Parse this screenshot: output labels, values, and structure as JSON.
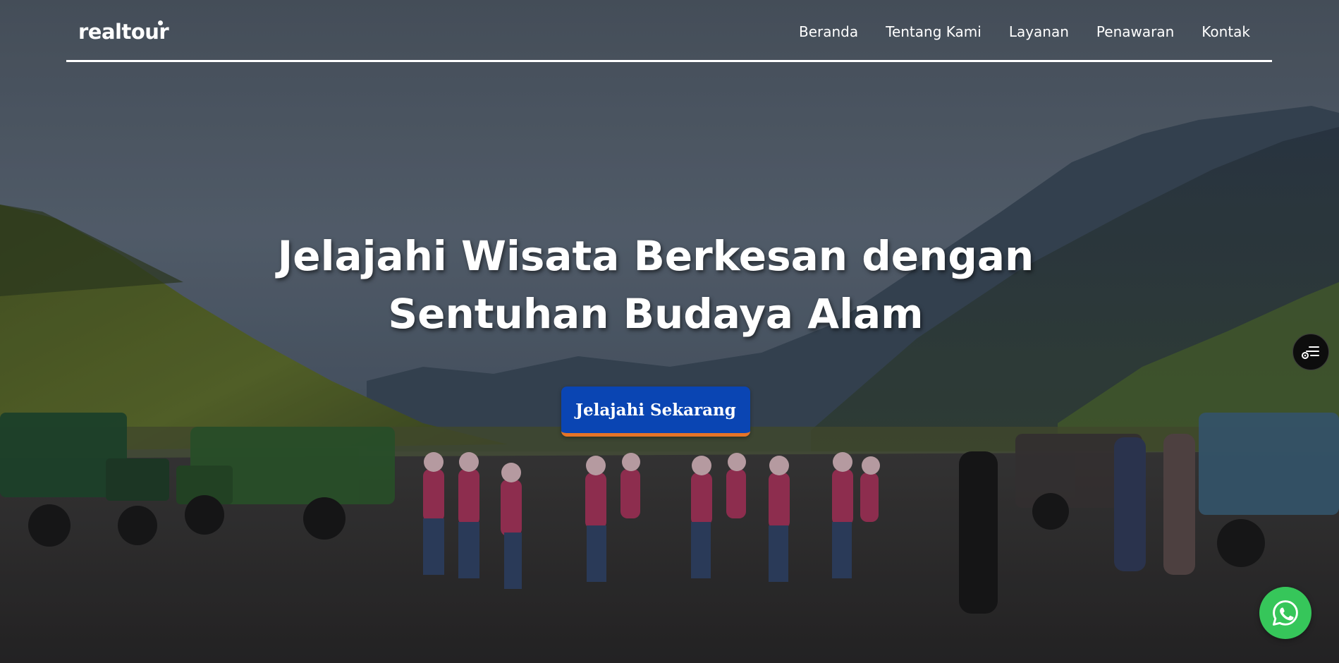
{
  "brand": {
    "logo_text": "realtour"
  },
  "nav": {
    "items": [
      {
        "label": "Beranda"
      },
      {
        "label": "Tentang Kami"
      },
      {
        "label": "Layanan"
      },
      {
        "label": "Penawaran"
      },
      {
        "label": "Kontak"
      }
    ]
  },
  "hero": {
    "title_line1": "Jelajahi Wisata Berkesan dengan",
    "title_line2": "Sentuhan Budaya Alam",
    "cta_label": "Jelajahi Sekarang",
    "background_image": "mountain-valley-group-photo"
  },
  "floating": {
    "side_menu_icon": "list-settings-icon",
    "whatsapp_icon": "whatsapp-icon"
  },
  "colors": {
    "cta_bg": "#0a45b3",
    "cta_border": "#e57427",
    "whatsapp_bg": "#36c65a",
    "nav_text": "#ffffff"
  }
}
